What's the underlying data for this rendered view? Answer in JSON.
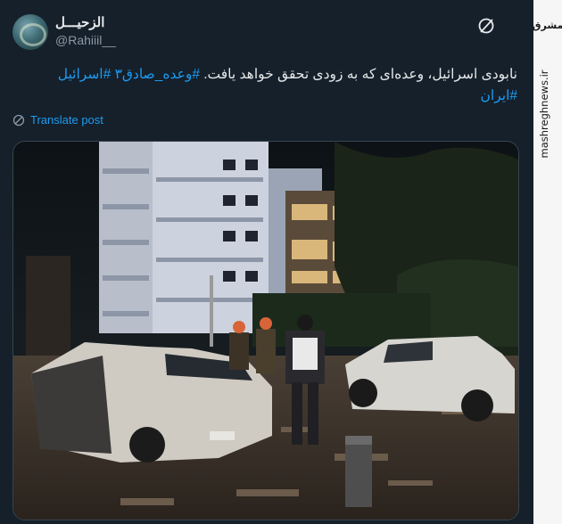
{
  "author": {
    "display_name": "الزحيـــل",
    "handle": "@Rahiiil__"
  },
  "tweet": {
    "text_plain": "نابودی اسرائیل، وعده‌ای که به زودی تحقق خواهد یافت.",
    "hashtag_1": "#وعده_صادق۳",
    "hashtag_2": "#اسرائیل",
    "hashtag_3": "#ایران"
  },
  "translate_label": "Translate post",
  "watermark": {
    "logo_text": "مشرق",
    "url": "mashreghnews.ir"
  },
  "icons": {
    "grok": "grok-icon",
    "globe": "translate-globe-icon"
  },
  "colors": {
    "background": "#15202b",
    "link": "#1d9bf0",
    "muted": "#8b98a5"
  }
}
